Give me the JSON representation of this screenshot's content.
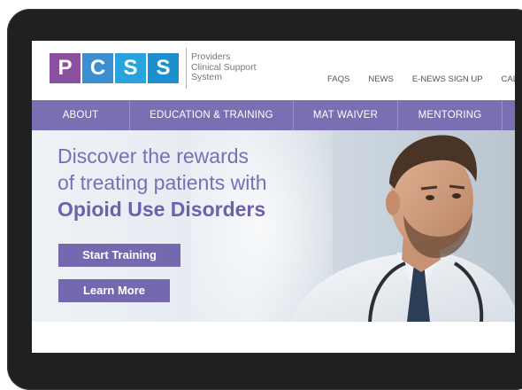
{
  "logo": {
    "letters": [
      "P",
      "C",
      "S",
      "S"
    ],
    "colors": [
      "#8a4f9e",
      "#3b8fd0",
      "#2aa3dc",
      "#1d8fcf"
    ],
    "subtitle_lines": [
      "Providers",
      "Clinical Support",
      "System"
    ]
  },
  "top_links": [
    "FAQS",
    "NEWS",
    "E-NEWS SIGN UP",
    "CALEND"
  ],
  "nav": {
    "items": [
      "ABOUT",
      "EDUCATION & TRAINING",
      "MAT WAIVER",
      "MENTORING"
    ]
  },
  "hero": {
    "line1": "Discover the rewards",
    "line2": "of treating patients with",
    "line3": "Opioid Use Disorders",
    "start_button": "Start Training",
    "learn_button": "Learn More"
  },
  "colors": {
    "accent": "#7b6fb3",
    "device": "#202020"
  }
}
